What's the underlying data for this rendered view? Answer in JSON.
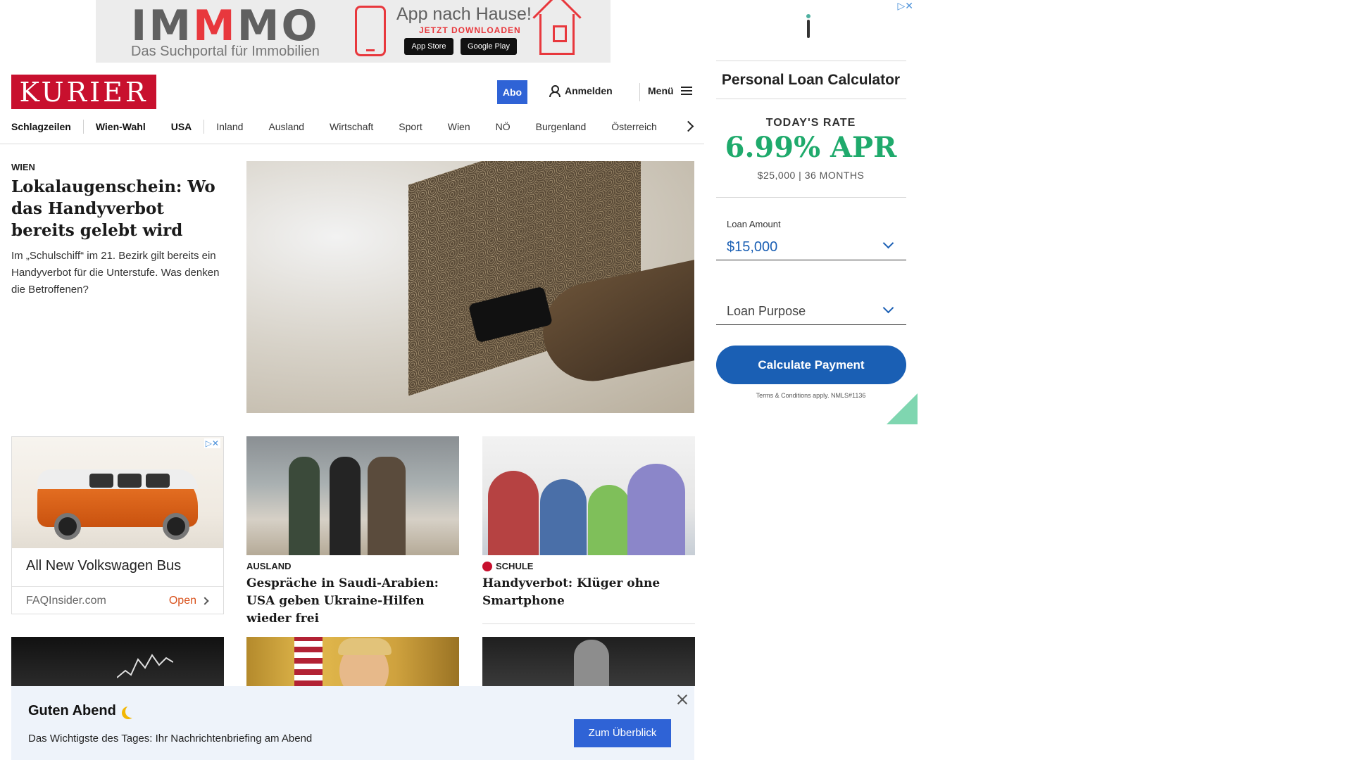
{
  "top_ad": {
    "brand_prefix": "IM",
    "brand_highlight": "M",
    "brand_suffix": "MO",
    "tagline": "Das Suchportal für Immobilien",
    "app_title": "App nach Hause!",
    "app_sub": "JETZT DOWNLOADEN",
    "apple_store": "App Store",
    "google_play": "Google Play",
    "accent_color": "#e8383d"
  },
  "header": {
    "logo": "KURIER",
    "logo_color": "#c8102e",
    "abo_label": "Abo",
    "login_label": "Anmelden",
    "menu_label": "Menü"
  },
  "nav": {
    "items": [
      "Schlagzeilen",
      "Wien-Wahl",
      "USA",
      "Inland",
      "Ausland",
      "Wirtschaft",
      "Sport",
      "Wien",
      "NÖ",
      "Burgenland",
      "Österreich"
    ]
  },
  "lead": {
    "kicker": "WIEN",
    "title": "Lokalaugenschein: Wo das Handyverbot bereits gelebt wird",
    "teaser": "Im „Schulschiff“ im 21. Bezirk gilt bereits ein Handyverbot für die Unterstufe. Was denken die Betroffenen?"
  },
  "vw_ad": {
    "title": "All New Volkswagen Bus",
    "domain": "FAQInsider.com",
    "cta": "Open"
  },
  "cards": [
    {
      "kicker": "AUSLAND",
      "title": "Gespräche in Saudi-Arabien: USA geben Ukraine-Hilfen wieder frei"
    },
    {
      "kicker": "SCHULE",
      "title": "Handyverbot: Klüger ohne Smartphone"
    }
  ],
  "briefing": {
    "title": "Guten Abend",
    "subtitle": "Das Wichtigste des Tages: Ihr Nachrichtenbriefing am Abend",
    "button": "Zum Überblick"
  },
  "loan_ad": {
    "title": "Personal Loan Calculator",
    "rate_label": "TODAY'S RATE",
    "rate": "6.99% APR",
    "terms": "$25,000 | 36 MONTHS",
    "amount_label": "Loan Amount",
    "amount_value": "$15,000",
    "purpose_placeholder": "Loan Purpose",
    "calc_button": "Calculate Payment",
    "disclaimer": "Terms & Conditions apply. NMLS#1136",
    "rate_color": "#1faa6c",
    "button_color": "#1a5fb4"
  }
}
